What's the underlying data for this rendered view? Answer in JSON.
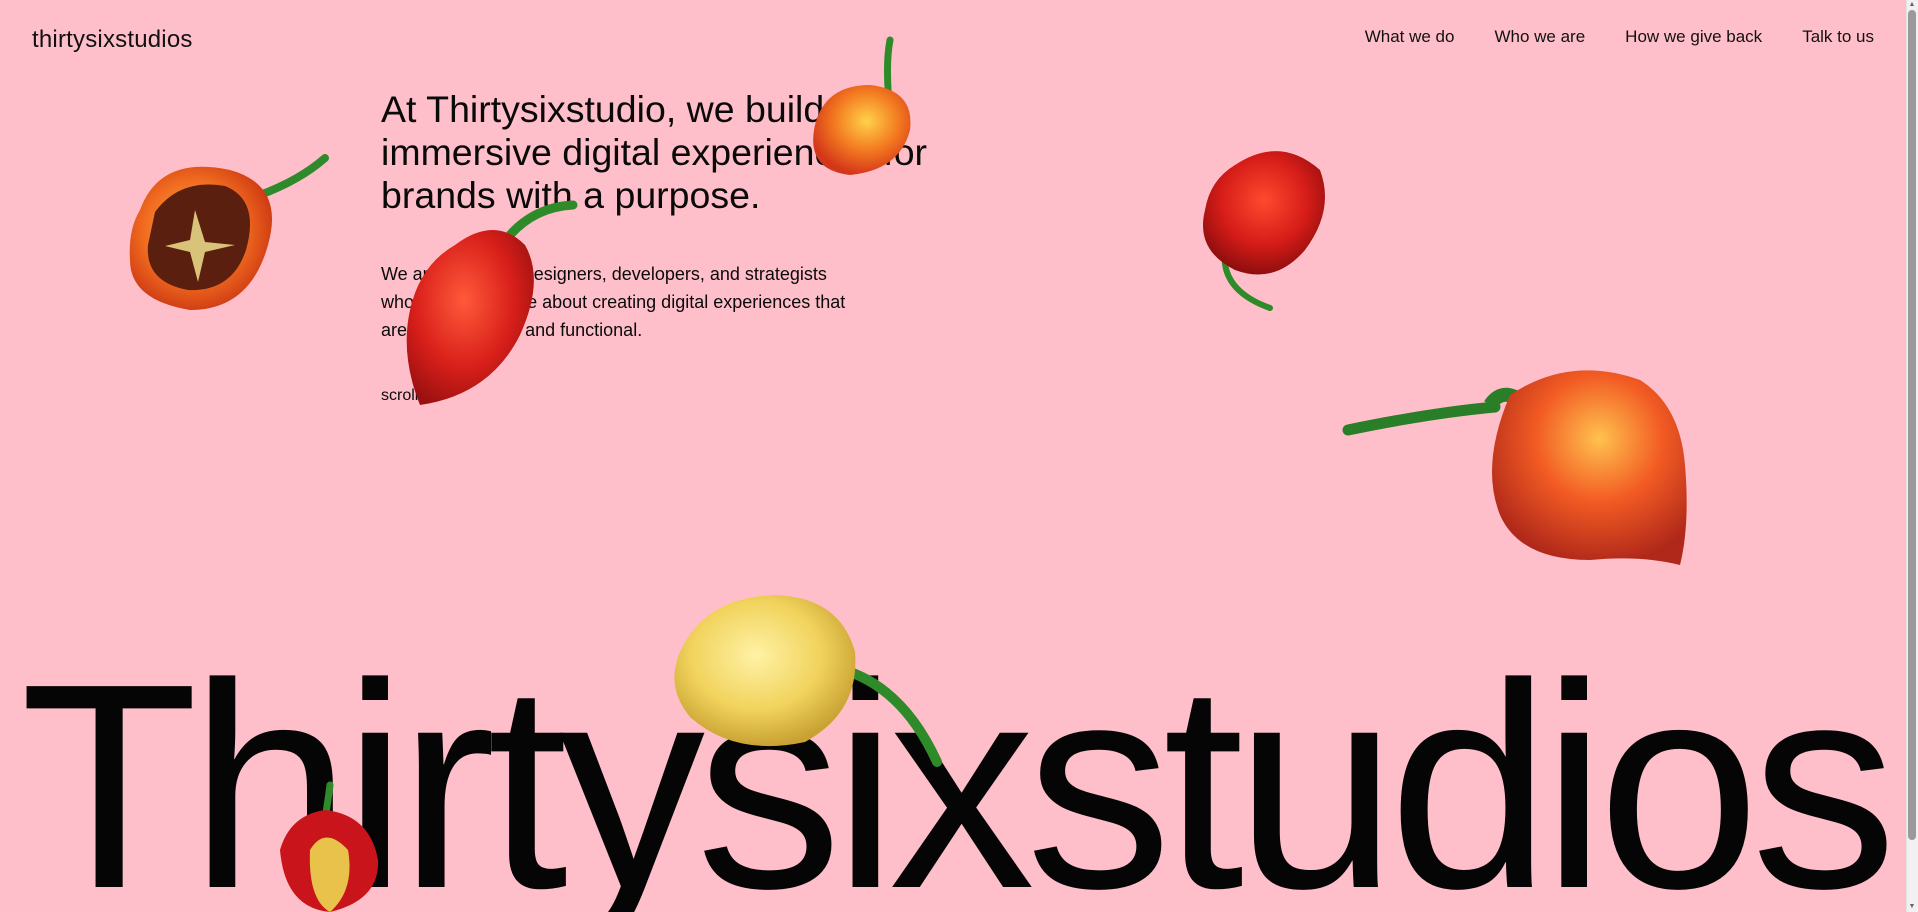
{
  "brand": {
    "logo_text": "thirtysixstudios"
  },
  "nav": {
    "items": [
      {
        "label": "What we do"
      },
      {
        "label": "Who we are"
      },
      {
        "label": "How we give back"
      },
      {
        "label": "Talk to us"
      }
    ]
  },
  "hero": {
    "headline": "At Thirtysixstudio, we build immersive digital experiences for brands with a purpose.",
    "description": "We are a team of designers, developers, and strategists who are passionate about creating digital experiences that are both beautiful and functional.",
    "scroll_hint": "scroll",
    "big_title": "Thirtysixstudios"
  },
  "theme": {
    "background": "#ffbfca",
    "text": "#0a0a0a"
  },
  "decorations": {
    "pepper_icons": [
      "pepper-halved-icon",
      "pepper-red-icon",
      "pepper-orange-icon",
      "pepper-yellow-icon"
    ]
  }
}
